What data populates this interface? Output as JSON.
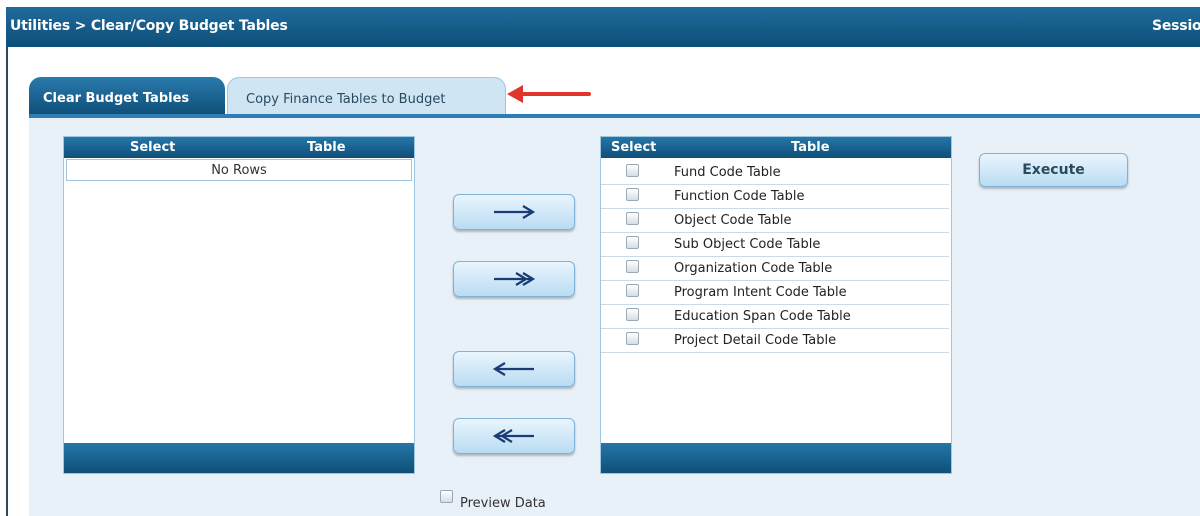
{
  "header": {
    "breadcrumb": "Utilities > Clear/Copy Budget Tables",
    "session": "Sessior"
  },
  "tabs": [
    {
      "label": "Clear Budget Tables",
      "active": false
    },
    {
      "label": "Copy Finance Tables to Budget",
      "active": true
    }
  ],
  "left_grid": {
    "columns": [
      "Select",
      "Table"
    ],
    "empty_text": "No Rows"
  },
  "right_grid": {
    "columns": [
      "Select",
      "Table"
    ],
    "rows": [
      {
        "label": "Fund Code Table",
        "checked": false
      },
      {
        "label": "Function Code Table",
        "checked": false
      },
      {
        "label": "Object Code Table",
        "checked": false
      },
      {
        "label": "Sub Object Code Table",
        "checked": false
      },
      {
        "label": "Organization Code Table",
        "checked": false
      },
      {
        "label": "Program Intent Code Table",
        "checked": false
      },
      {
        "label": "Education Span Code Table",
        "checked": false
      },
      {
        "label": "Project Detail Code Table",
        "checked": false
      }
    ]
  },
  "move_buttons": [
    {
      "icon": "arrow-right-icon",
      "glyph": "→"
    },
    {
      "icon": "double-arrow-right-icon",
      "glyph": "↠"
    },
    {
      "icon": "arrow-left-icon",
      "glyph": "←"
    },
    {
      "icon": "double-arrow-left-icon",
      "glyph": "↞"
    }
  ],
  "execute_label": "Execute",
  "preview": {
    "label": "Preview Data",
    "checked": false
  },
  "colors": {
    "header_blue": "#0e4f78",
    "tab_active_bg": "#cfe5f4",
    "panel_bg": "#e9f1f8",
    "button_bg": "#b9dcf3",
    "indicator_red": "#e0352b"
  }
}
